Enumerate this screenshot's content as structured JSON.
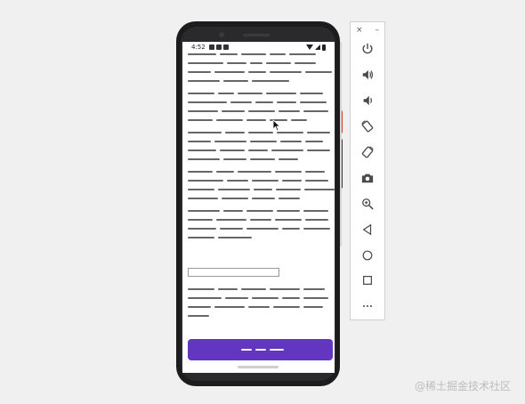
{
  "status_bar": {
    "time": "4:52"
  },
  "text_field": {
    "value": ""
  },
  "action_button": {
    "label": ""
  },
  "toolbar": {
    "close_glyph": "×",
    "minimize_glyph": "–",
    "items": [
      {
        "icon": "power-icon"
      },
      {
        "icon": "volume-up-icon"
      },
      {
        "icon": "volume-down-icon"
      },
      {
        "icon": "rotate-left-icon"
      },
      {
        "icon": "rotate-right-icon"
      },
      {
        "icon": "camera-icon"
      },
      {
        "icon": "zoom-icon"
      },
      {
        "icon": "back-icon"
      },
      {
        "icon": "home-icon"
      },
      {
        "icon": "overview-icon"
      },
      {
        "icon": "more-icon"
      }
    ]
  },
  "watermark": "@稀土掘金技术社区",
  "colors": {
    "primary_button": "#6236be",
    "placeholder_text": "#666666",
    "background": "#f0f0f0"
  }
}
